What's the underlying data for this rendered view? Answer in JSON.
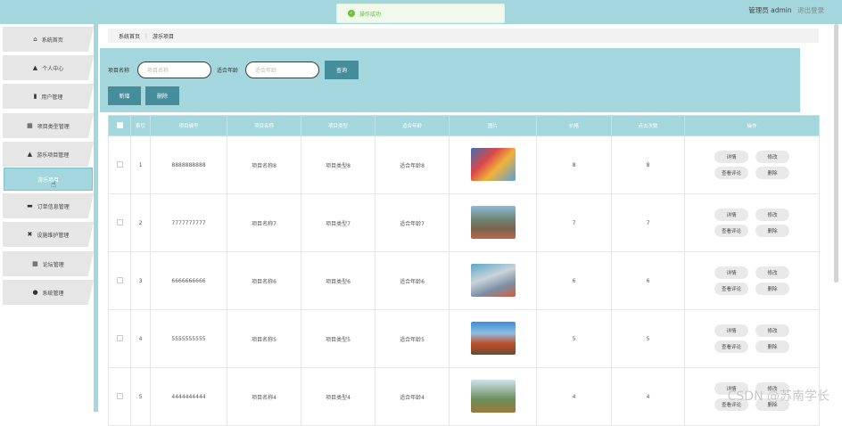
{
  "header": {
    "toast": "操作成功",
    "user_label": "管理员 admin",
    "logout_label": "退出登录"
  },
  "sidebar": {
    "items": [
      {
        "label": "系统首页",
        "icon": "home-icon",
        "glyph": "⌂"
      },
      {
        "label": "个人中心",
        "icon": "person-icon",
        "glyph": "▲"
      },
      {
        "label": "用户管理",
        "icon": "user-manage-icon",
        "glyph": "▮"
      },
      {
        "label": "项目类型管理",
        "icon": "grid-icon",
        "glyph": "▦"
      },
      {
        "label": "游乐项目管理",
        "icon": "person-icon",
        "glyph": "▲"
      },
      {
        "label": "订单信息管理",
        "icon": "bag-icon",
        "glyph": "▬"
      },
      {
        "label": "设施维护管理",
        "icon": "tool-icon",
        "glyph": "✖"
      },
      {
        "label": "论坛管理",
        "icon": "grid-icon",
        "glyph": "▦"
      },
      {
        "label": "系统管理",
        "icon": "pin-icon",
        "glyph": "●"
      }
    ],
    "active_sub": "游乐项目"
  },
  "breadcrumb": {
    "home": "系统首页",
    "separator": "⋮",
    "current": "游乐项目"
  },
  "search": {
    "name_label": "项目名称",
    "name_placeholder": "项目名称",
    "age_label": "适合年龄",
    "age_placeholder": "适合年龄",
    "query_button": "查询"
  },
  "actions": {
    "add": "新增",
    "delete": "删除"
  },
  "table": {
    "headers": [
      "索引",
      "项目编号",
      "项目名称",
      "项目类型",
      "适合年龄",
      "图片",
      "价格",
      "点击次数",
      "操作"
    ],
    "rows": [
      {
        "index": "1",
        "code": "8888888888",
        "name": "项目名称8",
        "type": "项目类型8",
        "age": "适合年龄8",
        "price": "8",
        "clicks": "8"
      },
      {
        "index": "2",
        "code": "7777777777",
        "name": "项目名称7",
        "type": "项目类型7",
        "age": "适合年龄7",
        "price": "7",
        "clicks": "7"
      },
      {
        "index": "3",
        "code": "6666666666",
        "name": "项目名称6",
        "type": "项目类型6",
        "age": "适合年龄6",
        "price": "6",
        "clicks": "6"
      },
      {
        "index": "4",
        "code": "5555555555",
        "name": "项目名称5",
        "type": "项目类型5",
        "age": "适合年龄5",
        "price": "5",
        "clicks": "5"
      },
      {
        "index": "5",
        "code": "4444444444",
        "name": "项目名称4",
        "type": "项目类型4",
        "age": "适合年龄4",
        "price": "4",
        "clicks": "4"
      }
    ],
    "ops": {
      "detail": "详情",
      "edit": "修改",
      "comments": "查看评论",
      "delete": "删除"
    }
  },
  "watermark": "CSDN @苏南学长",
  "colors": {
    "accent": "#a3d7dd",
    "button": "#458d9a"
  }
}
